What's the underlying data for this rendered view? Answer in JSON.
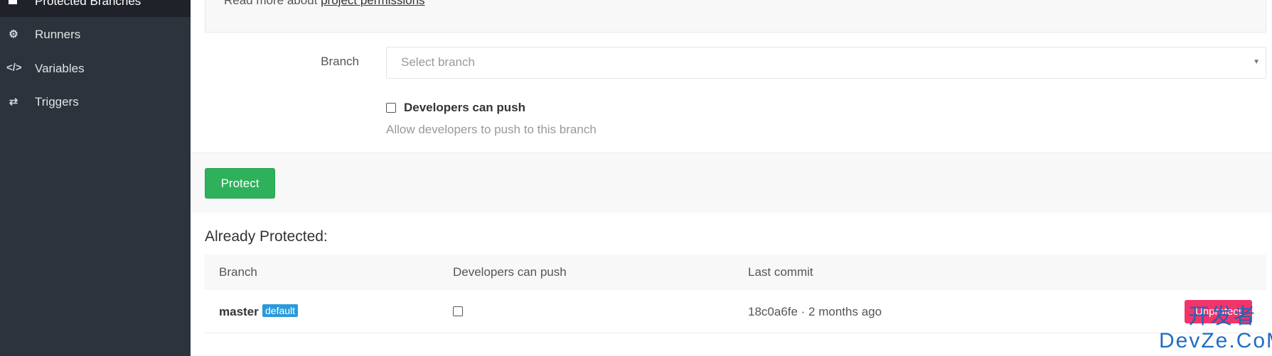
{
  "sidebar": {
    "active": {
      "label": "Protected Branches"
    },
    "items": [
      {
        "label": "Runners",
        "icon": "gear-icon"
      },
      {
        "label": "Variables",
        "icon": "code-icon"
      },
      {
        "label": "Triggers",
        "icon": "retweet-icon"
      }
    ]
  },
  "info": {
    "text": "Read more about ",
    "link": "project permissions"
  },
  "form": {
    "branch_label": "Branch",
    "branch_placeholder": "Select branch",
    "dev_push_label": "Developers can push",
    "dev_push_help": "Allow developers to push to this branch",
    "protect_label": "Protect"
  },
  "protected": {
    "title": "Already Protected:",
    "columns": [
      "Branch",
      "Developers can push",
      "Last commit"
    ],
    "rows": [
      {
        "branch": "master",
        "badge": "default",
        "commit": "18c0a6fe · 2 months ago",
        "action": "Unprotect"
      }
    ]
  },
  "watermark": {
    "line1": "开发者",
    "line2": "DevZe.CoM"
  }
}
